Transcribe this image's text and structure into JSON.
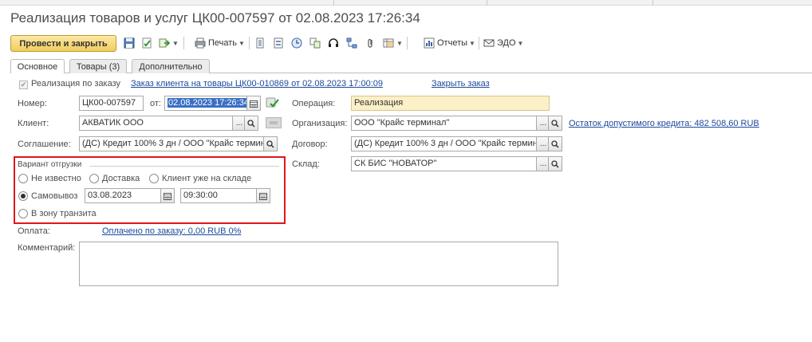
{
  "window": {
    "title": "Реализация товаров и услуг ЦК00-007597 от 02.08.2023 17:26:34"
  },
  "toolbar": {
    "post_close_label": "Провести и закрыть",
    "print_label": "Печать",
    "reports_label": "Отчеты",
    "edo_label": "ЭДО"
  },
  "tabs": [
    {
      "label": "Основное",
      "active": true
    },
    {
      "label": "Товары (3)",
      "active": false
    },
    {
      "label": "Дополнительно",
      "active": false
    }
  ],
  "order": {
    "checkbox_label": "Реализация по заказу",
    "checked": true,
    "order_link": "Заказ клиента на товары ЦК00-010869 от 02.08.2023 17:00:09",
    "close_link": "Закрыть заказ"
  },
  "form": {
    "number_label": "Номер:",
    "number_value": "ЦК00-007597",
    "date_label": "от:",
    "date_value": "02.08.2023 17:26:34",
    "operation_label": "Операция:",
    "operation_value": "Реализация",
    "client_label": "Клиент:",
    "client_value": "АКВАТИК ООО",
    "organization_label": "Организация:",
    "organization_value": "ООО \"Крайс терминал\"",
    "credit_link": "Остаток допустимого кредита: 482 508,60 RUB",
    "agreement_label": "Соглашение:",
    "agreement_value": "(ДС) Кредит 100% 3 дн / ООО \"Крайс термин",
    "contract_label": "Договор:",
    "contract_value": "(ДС) Кредит 100% 3 дн / ООО \"Крайс термин",
    "warehouse_label": "Склад:",
    "warehouse_value": "СК БИС \"НОВАТОР\""
  },
  "shipment": {
    "group_label": "Вариант отгрузки",
    "options": {
      "unknown": "Не известно",
      "delivery": "Доставка",
      "client_at_warehouse": "Клиент уже на складе",
      "pickup": "Самовывоз",
      "transit": "В зону транзита"
    },
    "selected": "pickup",
    "pickup_date": "03.08.2023",
    "pickup_time": "09:30:00"
  },
  "payment": {
    "label": "Оплата:",
    "link": "Оплачено по заказу: 0,00 RUB  0%"
  },
  "comment": {
    "label": "Комментарий:",
    "value": ""
  },
  "colors": {
    "highlight_box": "#e0161b",
    "link": "#1c4a9c",
    "primary_button": "#f2cd5a",
    "operation_field": "#fbf0c7"
  }
}
